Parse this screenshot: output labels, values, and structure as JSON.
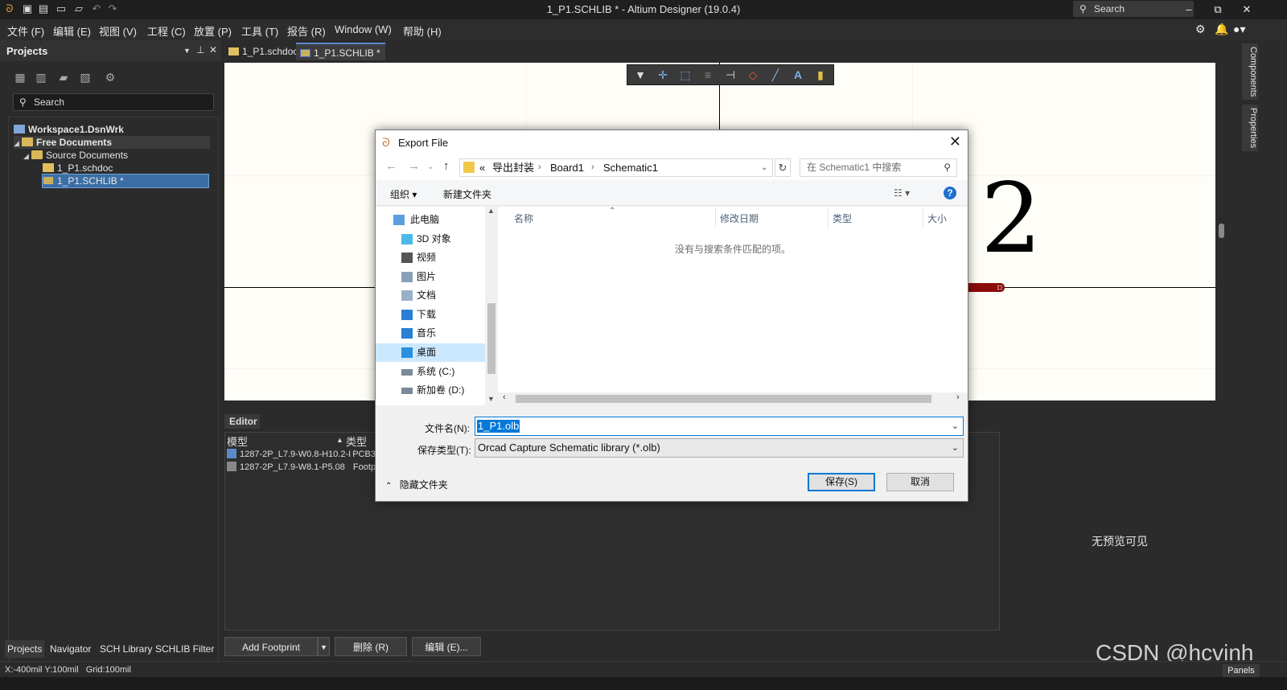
{
  "window": {
    "title": "1_P1.SCHLIB * - Altium Designer (19.0.4)",
    "search_placeholder": "Search",
    "minimize": "–",
    "restore": "⧉",
    "close": "✕"
  },
  "menu": [
    "文件 (F)",
    "编辑 (E)",
    "视图 (V)",
    "工程 (C)",
    "放置 (P)",
    "工具 (T)",
    "报告 (R)",
    "Window (W)",
    "帮助 (H)"
  ],
  "projects_panel": {
    "title": "Projects",
    "search_placeholder": "Search",
    "tree": {
      "workspace": "Workspace1.DsnWrk",
      "free_documents": "Free Documents",
      "source_documents": "Source Documents",
      "schdoc": "1_P1.schdoc",
      "schlib": "1_P1.SCHLIB *"
    },
    "bottom_tabs": [
      "Projects",
      "Navigator",
      "SCH Library",
      "SCHLIB Filter"
    ]
  },
  "doc_tabs": [
    "1_P1.schdoc",
    "1_P1.SCHLIB *"
  ],
  "canvas": {
    "pin_number": "2"
  },
  "right_tabs": [
    "Components",
    "Properties"
  ],
  "editor": {
    "label": "Editor",
    "columns": [
      "模型",
      "类型"
    ],
    "rows": [
      {
        "model": "1287-2P_L7.9-W0.8-H10.2-I",
        "type": "PCB3D"
      },
      {
        "model": "1287-2P_L7.9-W8.1-P5.08",
        "type": "Footpr"
      }
    ],
    "preview_text": "无预览可见",
    "buttons": {
      "add_footprint": "Add Footprint",
      "delete": "删除 (R)",
      "edit": "编辑 (E)..."
    }
  },
  "status": {
    "coords": "X:-400mil Y:100mil",
    "grid": "Grid:100mil",
    "panels": "Panels"
  },
  "watermark": "CSDN @hcvinh",
  "dialog": {
    "title": "Export File",
    "path": {
      "prefix": "«",
      "segments": [
        "导出封装",
        "Board1",
        "Schematic1"
      ]
    },
    "search_placeholder": "在 Schematic1 中搜索",
    "organize": "组织 ▾",
    "new_folder": "新建文件夹",
    "nav_items": [
      {
        "label": "此电脑",
        "icon": "computer-icon",
        "color": "#5aa0e0"
      },
      {
        "label": "3D 对象",
        "icon": "3d-objects-icon",
        "color": "#4ab8e8"
      },
      {
        "label": "视频",
        "icon": "video-icon",
        "color": "#555555"
      },
      {
        "label": "图片",
        "icon": "pictures-icon",
        "color": "#8aa0b8"
      },
      {
        "label": "文档",
        "icon": "documents-icon",
        "color": "#9ab0c8"
      },
      {
        "label": "下载",
        "icon": "download-icon",
        "color": "#2a7fd4"
      },
      {
        "label": "音乐",
        "icon": "music-icon",
        "color": "#2a7fd4"
      },
      {
        "label": "桌面",
        "icon": "desktop-icon",
        "color": "#2a90e0"
      },
      {
        "label": "系统 (C:)",
        "icon": "drive-c-icon",
        "color": "#7a8a9a"
      },
      {
        "label": "新加卷 (D:)",
        "icon": "drive-d-icon",
        "color": "#7a8a9a"
      }
    ],
    "list_columns": [
      "名称",
      "修改日期",
      "类型",
      "大小"
    ],
    "empty_message": "没有与搜索条件匹配的项。",
    "filename_label": "文件名(N):",
    "filename_value": "1_P1.olb",
    "filetype_label": "保存类型(T):",
    "filetype_value": "Orcad Capture Schematic library (*.olb)",
    "hide_folders": "隐藏文件夹",
    "save": "保存(S)",
    "cancel": "取消"
  }
}
